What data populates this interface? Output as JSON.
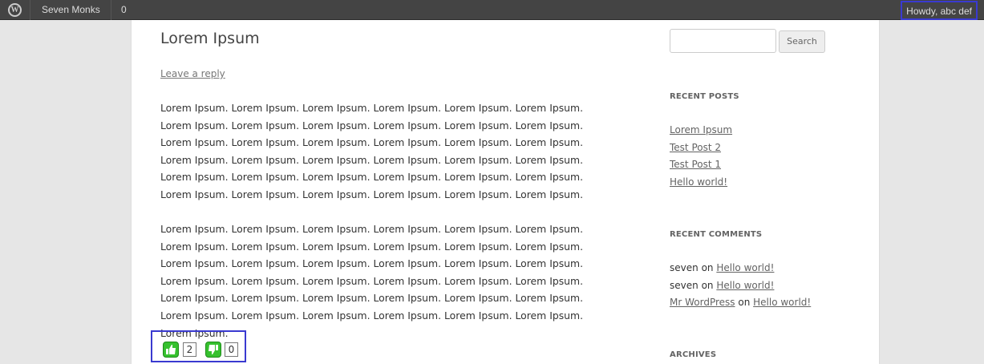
{
  "adminbar": {
    "site_name": "Seven Monks",
    "comments_count": "0",
    "howdy": "Howdy, abc def"
  },
  "post": {
    "title": "Lorem Ipsum",
    "leave_reply": "Leave a reply",
    "paragraph1": "Lorem Ipsum. Lorem Ipsum. Lorem Ipsum. Lorem Ipsum. Lorem Ipsum. Lorem Ipsum. Lorem Ipsum. Lorem Ipsum. Lorem Ipsum. Lorem Ipsum. Lorem Ipsum. Lorem Ipsum. Lorem Ipsum. Lorem Ipsum. Lorem Ipsum. Lorem Ipsum. Lorem Ipsum. Lorem Ipsum. Lorem Ipsum. Lorem Ipsum. Lorem Ipsum. Lorem Ipsum. Lorem Ipsum. Lorem Ipsum. Lorem Ipsum. Lorem Ipsum. Lorem Ipsum. Lorem Ipsum. Lorem Ipsum. Lorem Ipsum. Lorem Ipsum. Lorem Ipsum. Lorem Ipsum. Lorem Ipsum. Lorem Ipsum. Lorem Ipsum.",
    "paragraph2": "Lorem Ipsum. Lorem Ipsum. Lorem Ipsum. Lorem Ipsum. Lorem Ipsum. Lorem Ipsum. Lorem Ipsum. Lorem Ipsum. Lorem Ipsum. Lorem Ipsum. Lorem Ipsum. Lorem Ipsum. Lorem Ipsum. Lorem Ipsum. Lorem Ipsum. Lorem Ipsum. Lorem Ipsum. Lorem Ipsum. Lorem Ipsum. Lorem Ipsum. Lorem Ipsum. Lorem Ipsum. Lorem Ipsum. Lorem Ipsum. Lorem Ipsum. Lorem Ipsum. Lorem Ipsum. Lorem Ipsum. Lorem Ipsum. Lorem Ipsum. Lorem Ipsum. Lorem Ipsum. Lorem Ipsum. Lorem Ipsum. Lorem Ipsum. Lorem Ipsum. Lorem Ipsum.",
    "likes": "2",
    "dislikes": "0"
  },
  "sidebar": {
    "search_placeholder": "",
    "search_button": "Search",
    "recent_posts_title": "RECENT POSTS",
    "recent_posts": [
      "Lorem Ipsum",
      "Test Post 2",
      "Test Post 1",
      "Hello world!"
    ],
    "recent_comments_title": "RECENT COMMENTS",
    "recent_comments": [
      {
        "author": "seven",
        "on": "on",
        "post": "Hello world!"
      },
      {
        "author": "seven",
        "on": "on",
        "post": "Hello world!"
      },
      {
        "author": "Mr WordPress",
        "on": "on",
        "post": "Hello world!"
      }
    ],
    "archives_title": "ARCHIVES"
  },
  "colors": {
    "admin_bar": "#444444",
    "highlight_border": "#3a3ad0",
    "thumb_green": "#36c12e"
  },
  "icons": [
    "wordpress-logo-icon",
    "thumbs-up-icon",
    "thumbs-down-icon"
  ]
}
